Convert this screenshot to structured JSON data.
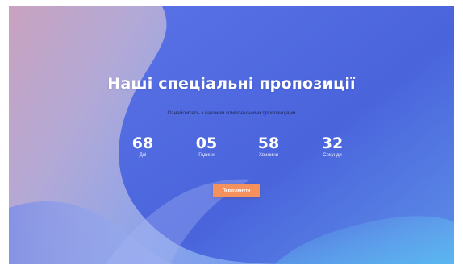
{
  "hero": {
    "title": "Наші спеціальні пропозиції",
    "subtitle": "Ознайомтесь з нашими комплексними пропозиціями",
    "button_label": "Переглянути"
  },
  "countdown": [
    {
      "value": "68",
      "label": "Дні"
    },
    {
      "value": "05",
      "label": "Години"
    },
    {
      "value": "58",
      "label": "Хвилини"
    },
    {
      "value": "32",
      "label": "Секунди"
    }
  ],
  "colors": {
    "button": "#f4915c",
    "gradient_start": "#c9a2bf",
    "gradient_mid": "#6f9cf0",
    "gradient_end": "#5cb6f0",
    "blob": "#4f6fe2"
  }
}
